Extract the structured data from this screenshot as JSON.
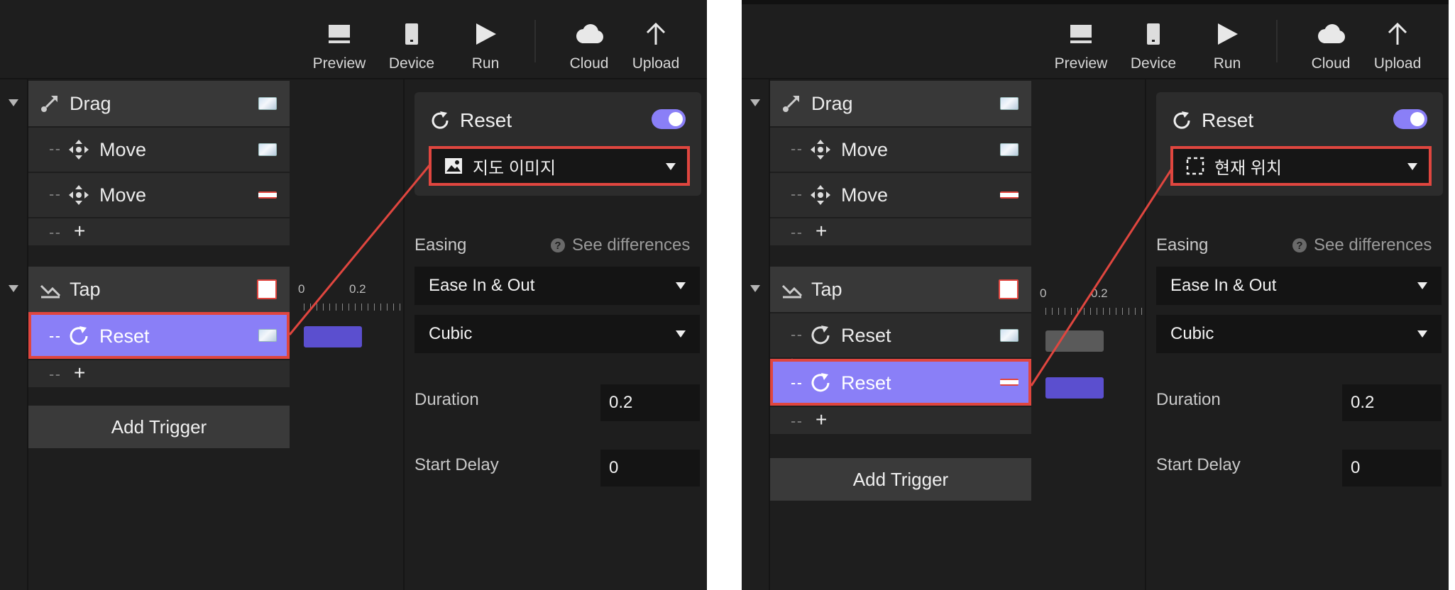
{
  "colors": {
    "background": "#1e1e1e",
    "selected_row": "#8a7ff7",
    "highlight_outline": "#e0463f",
    "timeline_bar_active": "#5b4fcf",
    "timeline_bar_inactive": "#5a5a5a"
  },
  "toolbar": {
    "preview": "Preview",
    "device": "Device",
    "run": "Run",
    "cloud": "Cloud",
    "upload": "Upload"
  },
  "panels": [
    {
      "triggers": [
        {
          "label": "Drag",
          "icon": "drag-icon",
          "rows": [
            {
              "label": "Move",
              "icon": "move-icon",
              "thumb": "image-thumb"
            },
            {
              "label": "Move",
              "icon": "move-icon",
              "thumb": "line-thumb"
            }
          ],
          "add": "+"
        },
        {
          "label": "Tap",
          "icon": "tap-icon",
          "rows": [
            {
              "label": "Reset",
              "icon": "reset-icon",
              "thumb": "image-thumb",
              "selected": true
            }
          ],
          "add": "+"
        }
      ],
      "add_trigger": "Add Trigger",
      "timeline": {
        "tick0": "0",
        "tick1": "0.2"
      },
      "inspector": {
        "title": "Reset",
        "enabled": true,
        "target": "지도 이미지",
        "target_icon": "image-icon",
        "easing_label": "Easing",
        "see_differences": "See differences",
        "easing": "Ease In & Out",
        "curve": "Cubic",
        "duration_label": "Duration",
        "duration": "0.2",
        "start_delay_label": "Start Delay",
        "start_delay": "0"
      }
    },
    {
      "triggers": [
        {
          "label": "Drag",
          "icon": "drag-icon",
          "rows": [
            {
              "label": "Move",
              "icon": "move-icon",
              "thumb": "image-thumb"
            },
            {
              "label": "Move",
              "icon": "move-icon",
              "thumb": "line-thumb"
            }
          ],
          "add": "+"
        },
        {
          "label": "Tap",
          "icon": "tap-icon",
          "rows": [
            {
              "label": "Reset",
              "icon": "reset-icon",
              "thumb": "image-thumb"
            },
            {
              "label": "Reset",
              "icon": "reset-icon",
              "thumb": "line-thumb",
              "selected": true
            }
          ],
          "add": "+"
        }
      ],
      "add_trigger": "Add Trigger",
      "timeline": {
        "tick0": "0",
        "tick1": "0.2"
      },
      "inspector": {
        "title": "Reset",
        "enabled": true,
        "target": "현재 위치",
        "target_icon": "selection-frame-icon",
        "easing_label": "Easing",
        "see_differences": "See differences",
        "easing": "Ease In & Out",
        "curve": "Cubic",
        "duration_label": "Duration",
        "duration": "0.2",
        "start_delay_label": "Start Delay",
        "start_delay": "0"
      }
    }
  ]
}
